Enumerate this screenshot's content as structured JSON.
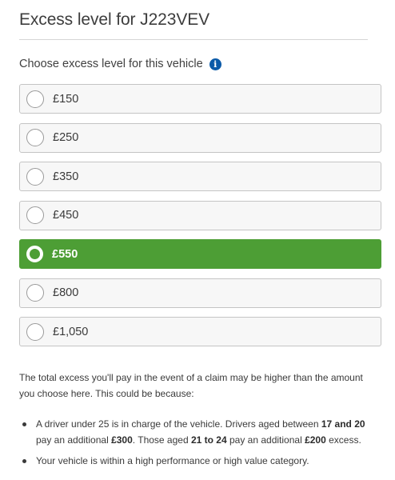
{
  "page": {
    "title": "Excess level for J223VEV"
  },
  "question": {
    "label": "Choose excess level for this vehicle",
    "info_icon": "info-icon"
  },
  "options": [
    {
      "label": "£150",
      "selected": false
    },
    {
      "label": "£250",
      "selected": false
    },
    {
      "label": "£350",
      "selected": false
    },
    {
      "label": "£450",
      "selected": false
    },
    {
      "label": "£550",
      "selected": true
    },
    {
      "label": "£800",
      "selected": false
    },
    {
      "label": "£1,050",
      "selected": false
    }
  ],
  "info_text": "The total excess you'll pay in the event of a claim may be higher than the amount you choose here. This could be because:",
  "reasons": {
    "driver": {
      "p1": "A driver under 25 is in charge of the vehicle. Drivers aged between ",
      "b1": "17 and 20",
      "p2": " pay an additional ",
      "b2": "£300",
      "p3": ". Those aged ",
      "b3": "21 to 24",
      "p4": " pay an additional ",
      "b4": "£200",
      "p5": " excess."
    },
    "vehicle": "Your vehicle is within a high performance or high value category."
  },
  "colors": {
    "selected": "#4d9e35",
    "info_icon": "#0b5aa8"
  }
}
